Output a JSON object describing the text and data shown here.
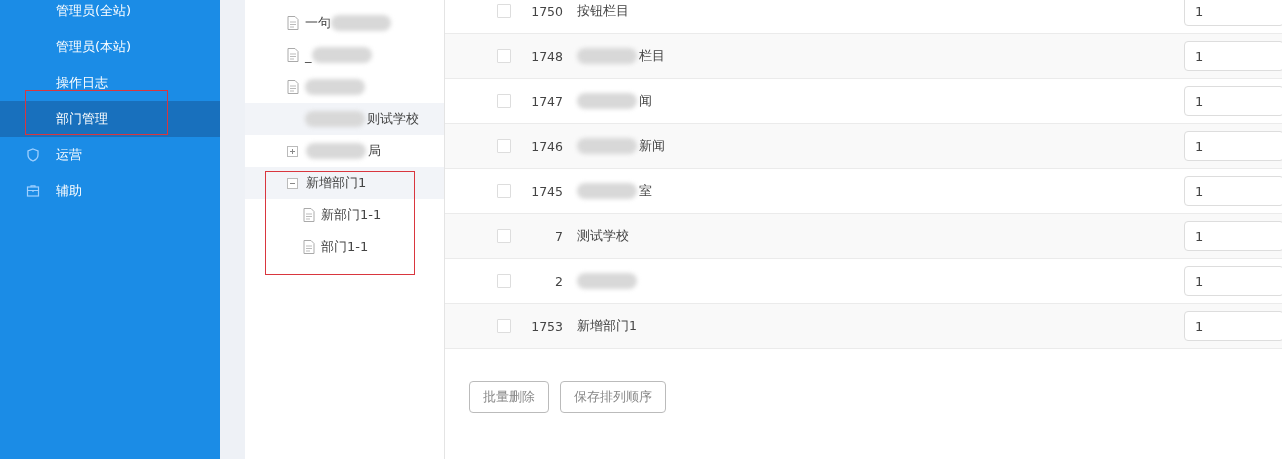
{
  "sidebar": {
    "items": [
      {
        "label": "管理员(全站)",
        "selected": false,
        "kind": "page"
      },
      {
        "label": "管理员(本站)",
        "selected": false,
        "kind": "page"
      },
      {
        "label": "操作日志",
        "selected": false,
        "kind": "page"
      },
      {
        "label": "部门管理",
        "selected": true,
        "kind": "page"
      },
      {
        "label": "运营",
        "selected": false,
        "kind": "group"
      },
      {
        "label": "辅助",
        "selected": false,
        "kind": "group"
      }
    ]
  },
  "tree": {
    "items": [
      {
        "label": "一句",
        "kind": "leaf",
        "selected": false,
        "blurred_after": true
      },
      {
        "label": "_",
        "kind": "leaf",
        "selected": false,
        "blurred_after": true
      },
      {
        "kind": "leaf",
        "selected": false,
        "blurred_after": true
      },
      {
        "label": "则试学校",
        "kind": "plain",
        "selected": true,
        "blurred_before": true
      },
      {
        "label": "局",
        "kind": "collapsed",
        "selected": false,
        "blurred_before": true
      },
      {
        "label": "新增部门1",
        "kind": "expanded",
        "selected": true,
        "children": [
          {
            "label": "新部门1-1",
            "kind": "leaf",
            "selected": false
          },
          {
            "label": "部门1-1",
            "kind": "leaf",
            "selected": false
          }
        ]
      }
    ]
  },
  "table": {
    "rows": [
      {
        "checked": false,
        "id": "1750",
        "name": "按钮栏目",
        "order": "1"
      },
      {
        "checked": false,
        "id": "1748",
        "name": "栏目",
        "blurred_before": true,
        "order": "1"
      },
      {
        "checked": false,
        "id": "1747",
        "name": "闻",
        "blurred_before": true,
        "order": "1"
      },
      {
        "checked": false,
        "id": "1746",
        "name": "新闻",
        "blurred_before": true,
        "order": "1"
      },
      {
        "checked": false,
        "id": "1745",
        "name": "室",
        "blurred_before": true,
        "order": "1"
      },
      {
        "checked": false,
        "id": "7",
        "name": "测试学校",
        "order": "1"
      },
      {
        "checked": false,
        "id": "2",
        "blurred_before": true,
        "order": "1"
      },
      {
        "checked": false,
        "id": "1753",
        "name": "新增部门1",
        "order": "1"
      }
    ]
  },
  "buttons": [
    "批量删除",
    "保存排列顺序"
  ]
}
